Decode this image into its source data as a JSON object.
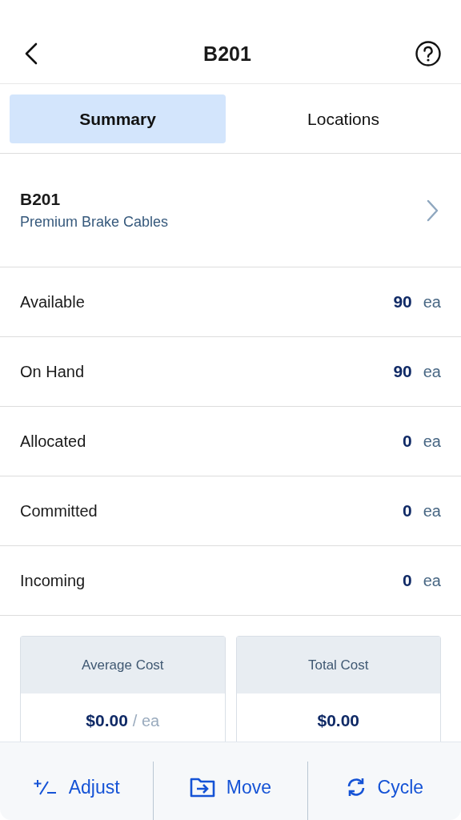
{
  "header": {
    "title": "B201"
  },
  "tabs": [
    {
      "label": "Summary",
      "selected": true
    },
    {
      "label": "Locations",
      "selected": false
    }
  ],
  "item": {
    "code": "B201",
    "name": "Premium Brake Cables"
  },
  "quantities": [
    {
      "label": "Available",
      "value": "90",
      "unit": "ea"
    },
    {
      "label": "On Hand",
      "value": "90",
      "unit": "ea"
    },
    {
      "label": "Allocated",
      "value": "0",
      "unit": "ea"
    },
    {
      "label": "Committed",
      "value": "0",
      "unit": "ea"
    },
    {
      "label": "Incoming",
      "value": "0",
      "unit": "ea"
    }
  ],
  "costs": [
    {
      "label": "Average Cost",
      "value": "$0.00",
      "unit": "/ ea"
    },
    {
      "label": "Total Cost",
      "value": "$0.00"
    }
  ],
  "actions": [
    {
      "kind": "adjust",
      "label": "Adjust"
    },
    {
      "kind": "move",
      "label": "Move"
    },
    {
      "kind": "cycle",
      "label": "Cycle"
    }
  ]
}
